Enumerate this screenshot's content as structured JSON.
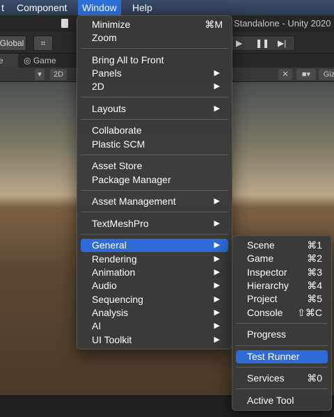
{
  "menubar": {
    "items": [
      {
        "label": "t"
      },
      {
        "label": "Component"
      },
      {
        "label": "Window"
      },
      {
        "label": "Help"
      }
    ]
  },
  "window": {
    "title": "Standalone - Unity 2020"
  },
  "toolbar": {
    "global_label": "Global"
  },
  "tabs": [
    {
      "label": "e"
    },
    {
      "label": "Game"
    }
  ],
  "scenebar": {
    "mode_2d": "2D",
    "gizmos_label": "Giz"
  },
  "window_menu": {
    "items": [
      {
        "label": "Minimize",
        "shortcut": "⌘M"
      },
      {
        "label": "Zoom"
      },
      {
        "label": "Bring All to Front"
      },
      {
        "label": "Panels"
      },
      {
        "label": "2D"
      },
      {
        "label": "Layouts"
      },
      {
        "label": "Collaborate"
      },
      {
        "label": "Plastic SCM"
      },
      {
        "label": "Asset Store"
      },
      {
        "label": "Package Manager"
      },
      {
        "label": "Asset Management"
      },
      {
        "label": "TextMeshPro"
      },
      {
        "label": "General"
      },
      {
        "label": "Rendering"
      },
      {
        "label": "Animation"
      },
      {
        "label": "Audio"
      },
      {
        "label": "Sequencing"
      },
      {
        "label": "Analysis"
      },
      {
        "label": "AI"
      },
      {
        "label": "UI Toolkit"
      }
    ]
  },
  "general_submenu": {
    "items": [
      {
        "label": "Scene",
        "shortcut": "⌘1"
      },
      {
        "label": "Game",
        "shortcut": "⌘2"
      },
      {
        "label": "Inspector",
        "shortcut": "⌘3"
      },
      {
        "label": "Hierarchy",
        "shortcut": "⌘4"
      },
      {
        "label": "Project",
        "shortcut": "⌘5"
      },
      {
        "label": "Console",
        "shortcut": "⇧⌘C"
      },
      {
        "label": "Progress"
      },
      {
        "label": "Test Runner"
      },
      {
        "label": "Services",
        "shortcut": "⌘0"
      },
      {
        "label": "Active Tool"
      }
    ]
  },
  "colors": {
    "highlight": "#2e6bd6",
    "menu_bg": "#3a3a3a"
  }
}
